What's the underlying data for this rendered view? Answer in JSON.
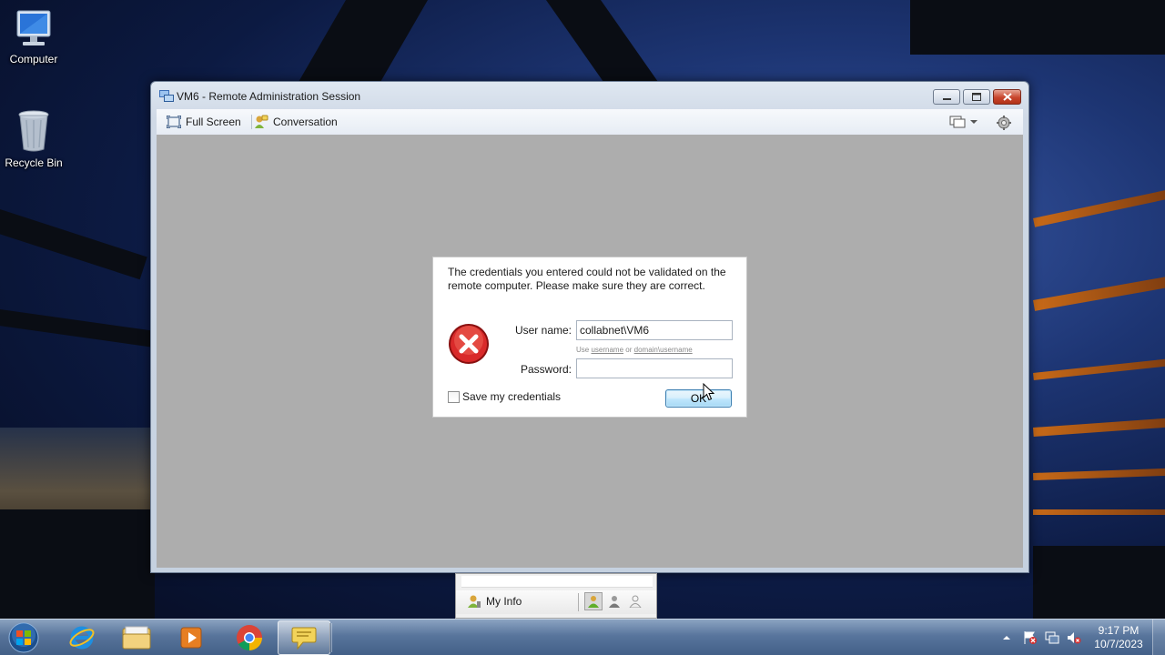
{
  "desktop": {
    "icons": [
      {
        "label": "Computer"
      },
      {
        "label": "Recycle Bin"
      }
    ]
  },
  "window": {
    "title": "VM6 - Remote Administration Session",
    "toolbar": {
      "full_screen": "Full Screen",
      "conversation": "Conversation"
    }
  },
  "dialog": {
    "message": "The credentials you entered could not be validated on the remote computer. Please make sure they are correct.",
    "username_label": "User name:",
    "username_value": "collabnet\\VM6",
    "hint_prefix": "Use",
    "hint_username": "username",
    "hint_or": "or",
    "hint_domain": "domain\\username",
    "password_label": "Password:",
    "password_value": "",
    "save_credentials_label": "Save my credentials",
    "save_credentials_checked": false,
    "ok_label": "OK"
  },
  "myinfo": {
    "label": "My Info"
  },
  "taskbar": {
    "apps": [
      "internet-explorer",
      "windows-explorer",
      "media-player",
      "chrome",
      "messenger"
    ],
    "active_app": "messenger",
    "clock_time": "9:17 PM",
    "clock_date": "10/7/2023"
  },
  "colors": {
    "ok_button": "#bee6fd",
    "close_button": "#c8452d",
    "viewport_gray": "#adadad"
  }
}
